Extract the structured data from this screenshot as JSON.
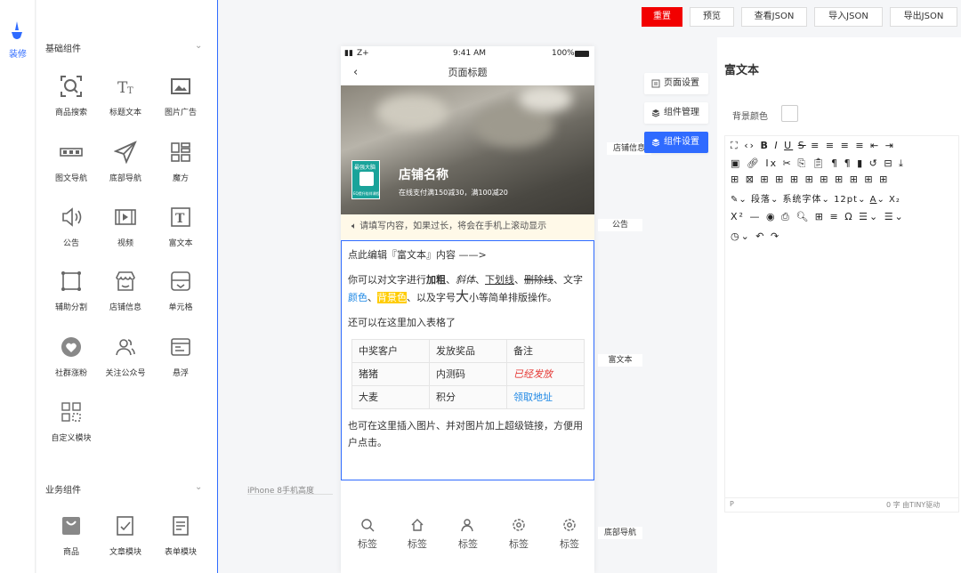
{
  "leftnav": {
    "label": "装修"
  },
  "panel": {
    "basic_title": "基础组件",
    "basic_items": [
      "商品搜索",
      "标题文本",
      "图片广告",
      "图文导航",
      "底部导航",
      "魔方",
      "公告",
      "视频",
      "富文本",
      "辅助分割",
      "店铺信息",
      "单元格",
      "社群涨粉",
      "关注公众号",
      "悬浮",
      "自定义模块"
    ],
    "biz_title": "业务组件",
    "biz_items": [
      "商品",
      "文章模块",
      "表单模块"
    ]
  },
  "canvas_note": "iPhone 8手机高度",
  "phone": {
    "carrier": "Z+",
    "time": "9:41 AM",
    "battery": "100%",
    "back": "‹",
    "title": "页面标题",
    "logo_top": "最强大脑",
    "logo_bottom": "EQ提升陪伴课程",
    "shop_name": "店铺名称",
    "promo": "在线支付满150减30，满100减20",
    "notice": "请填写内容，如果过长，将会在手机上滚动显示",
    "rich": {
      "p1": "点此编辑『富文本』内容 ——>",
      "p2_a": "你可以对文字进行",
      "p2_bold": "加粗",
      "p2_sep1": "、",
      "p2_italic": "斜体",
      "p2_sep2": "、",
      "p2_underline": "下划线",
      "p2_sep3": "、",
      "p2_strike": "删除线",
      "p2_sep4": "、文字",
      "p2_color": "颜色",
      "p2_sep5": "、",
      "p2_bg": "背景色",
      "p2_sep6": "、以及字号",
      "p2_big": "大",
      "p2_end": "小等简单排版操作。",
      "p3": "还可以在这里加入表格了",
      "table": [
        [
          "中奖客户",
          "发放奖品",
          "备注"
        ],
        [
          "猪猪",
          "内测码",
          "已经发放"
        ],
        [
          "大麦",
          "积分",
          "领取地址"
        ]
      ],
      "p4": "也可在这里插入图片、并对图片加上超级链接，方便用户点击。"
    },
    "tabs": [
      "标签",
      "标签",
      "标签",
      "标签",
      "标签"
    ]
  },
  "tags": {
    "shop": "店铺信息",
    "notice": "公告",
    "rich": "富文本",
    "bottom": "底部导航"
  },
  "side_buttons": [
    "页面设置",
    "组件管理",
    "组件设置"
  ],
  "top_buttons": [
    "重置",
    "预览",
    "查看JSON",
    "导入JSON",
    "导出JSON"
  ],
  "editor": {
    "title": "富文本",
    "bg_label": "背景颜色",
    "para_select": "段落",
    "font_select": "系统字体",
    "size_select": "12pt",
    "status_left": "P",
    "status_right": "0 字  由TINY驱动"
  },
  "colors": {
    "accent": "#2f6bff",
    "danger": "#f20000",
    "highlight": "#ffcc00",
    "link": "#1e88e5"
  }
}
